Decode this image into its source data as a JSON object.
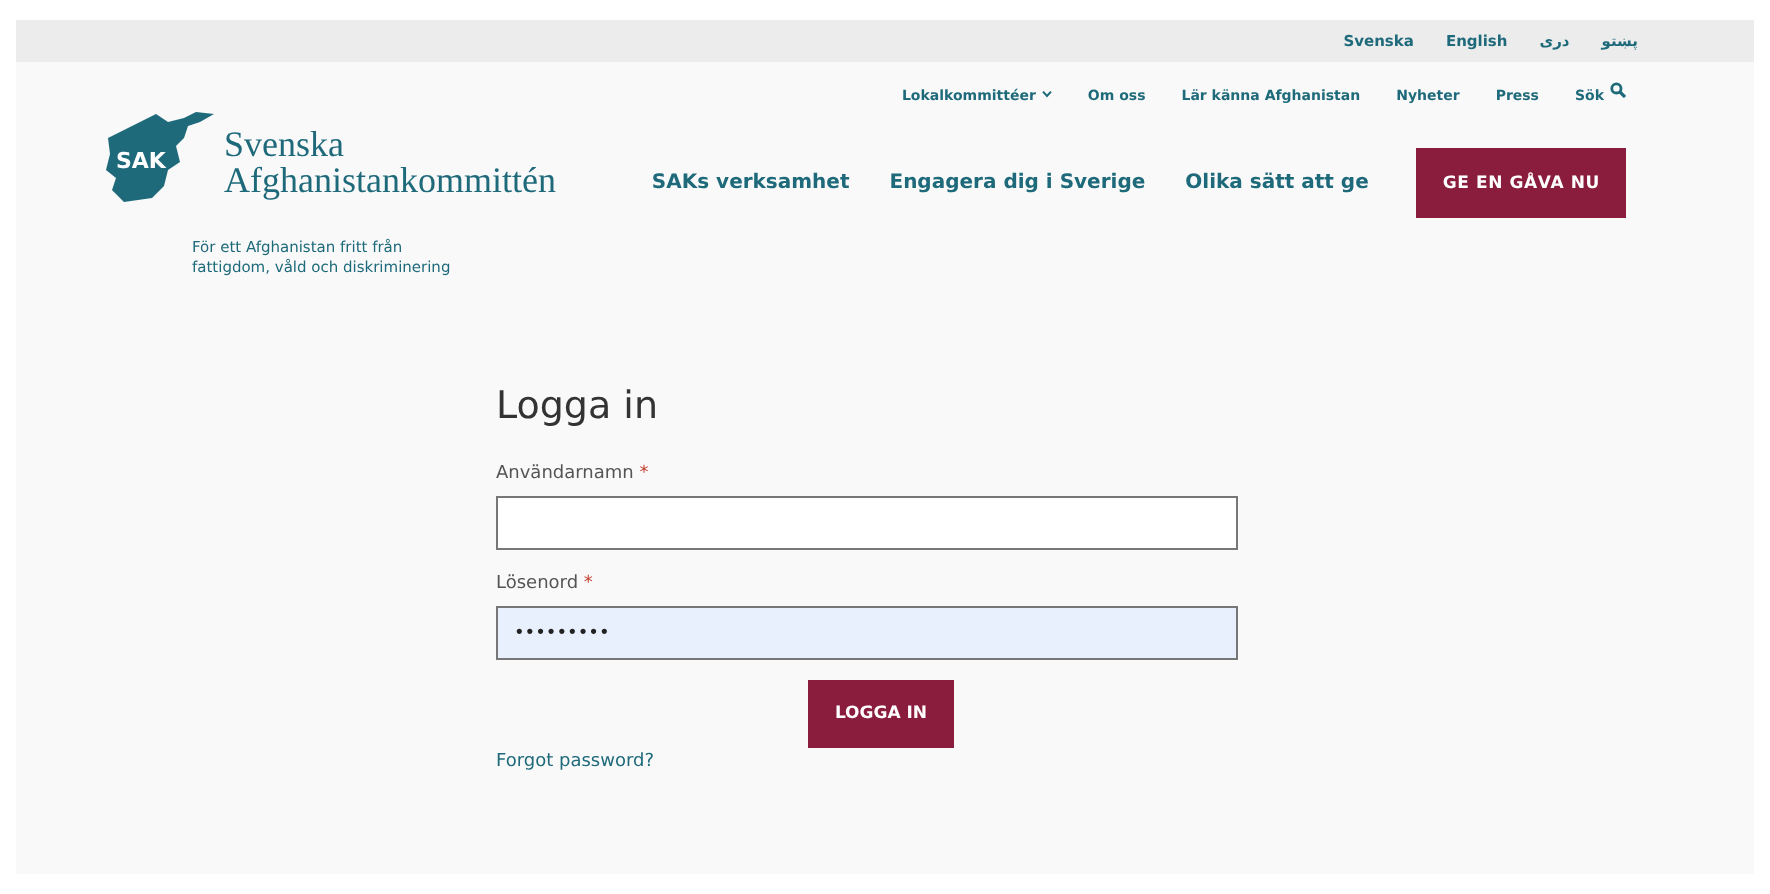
{
  "language_bar": [
    {
      "label": "Svenska"
    },
    {
      "label": "English"
    },
    {
      "label": "دری"
    },
    {
      "label": "پښتو"
    }
  ],
  "logo": {
    "badge": "SAK",
    "name_line_1": "Svenska",
    "name_line_2": "Afghanistankommittén",
    "tagline_line_1": "För ett Afghanistan fritt från",
    "tagline_line_2": "fattigdom, våld och diskriminering"
  },
  "top_nav": [
    {
      "label": "Lokalkommittéer",
      "kind": "dropdown"
    },
    {
      "label": "Om oss",
      "kind": "link"
    },
    {
      "label": "Lär känna Afghanistan",
      "kind": "link"
    },
    {
      "label": "Nyheter",
      "kind": "link"
    },
    {
      "label": "Press",
      "kind": "link"
    },
    {
      "label": "Sök",
      "kind": "search"
    }
  ],
  "main_nav": [
    {
      "label": "SAKs verksamhet"
    },
    {
      "label": "Engagera dig i Sverige"
    },
    {
      "label": "Olika sätt att ge"
    }
  ],
  "donate_button": "GE EN GÅVA NU",
  "login": {
    "title": "Logga in",
    "fields": [
      {
        "label": "Användarnamn",
        "required_mark": "*",
        "autofilled": false
      },
      {
        "label": "Lösenord",
        "required_mark": "*",
        "value": "•••••••••",
        "autofilled": true
      }
    ],
    "submit": "LOGGA IN",
    "forgot_link": "Forgot password?"
  }
}
